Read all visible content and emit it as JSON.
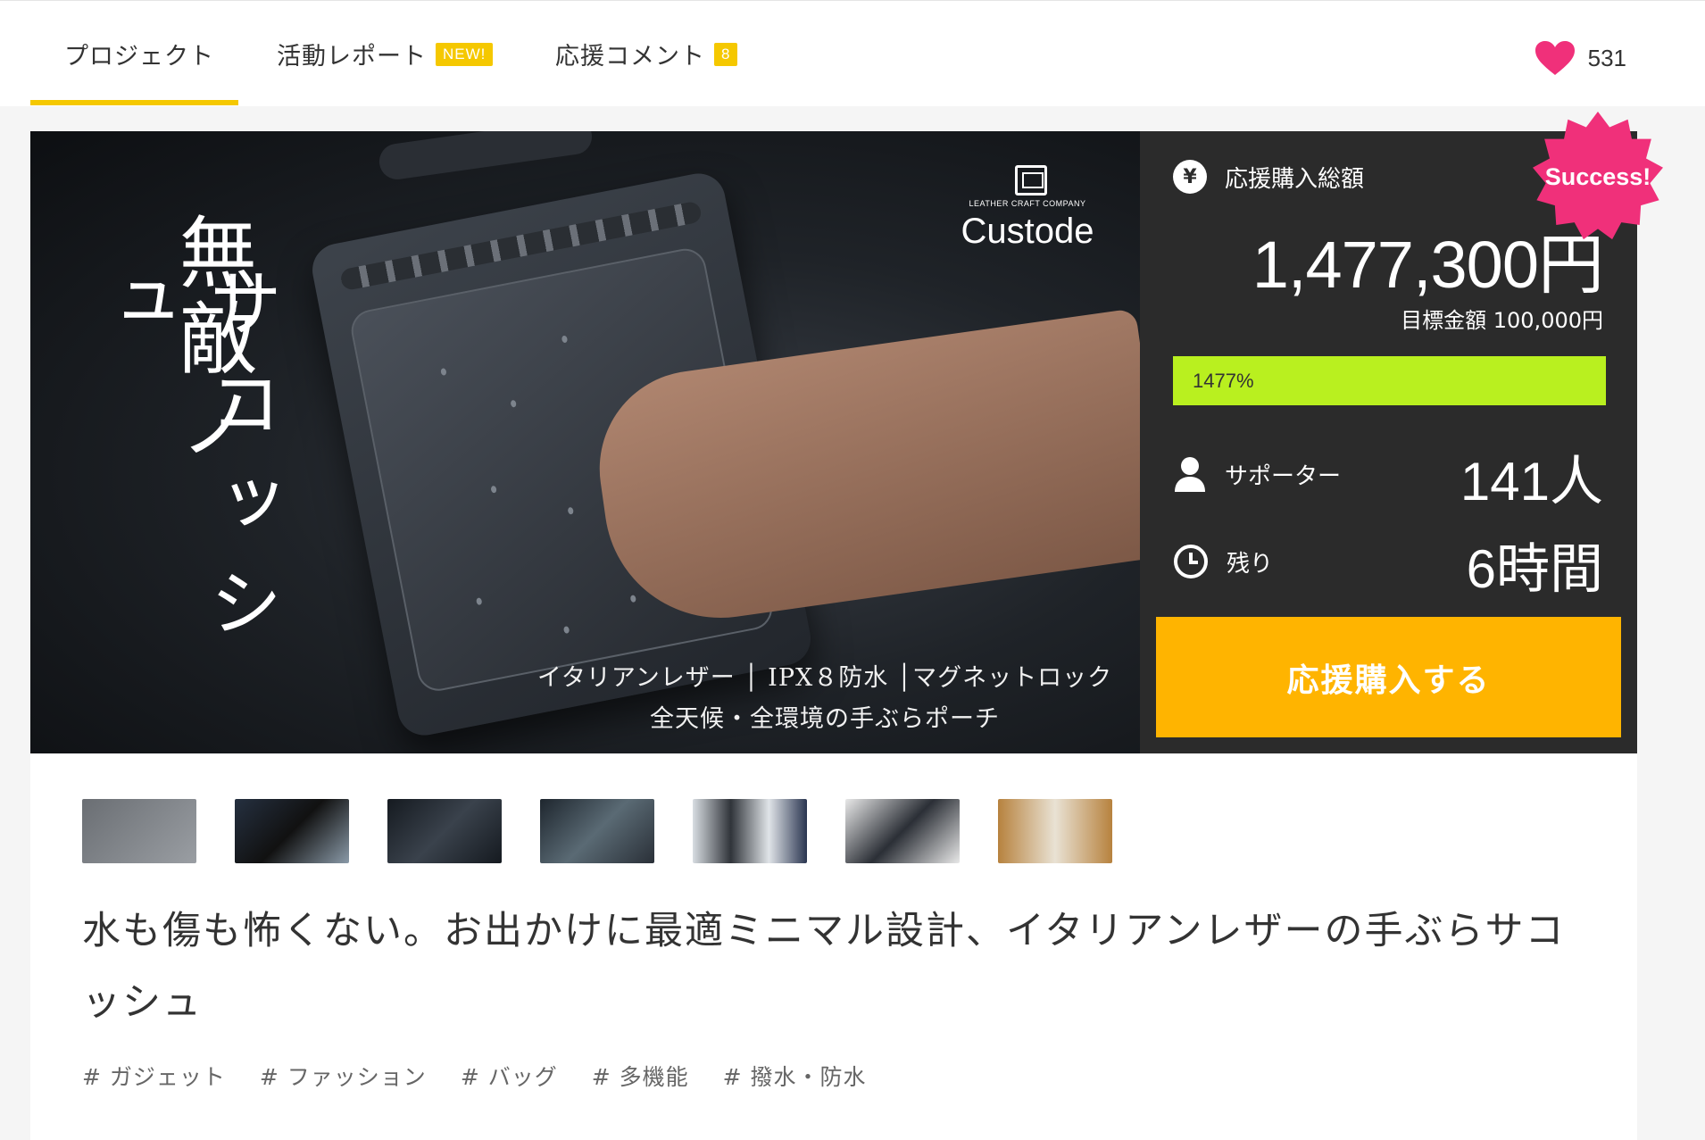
{
  "nav": {
    "tabs": [
      {
        "label": "プロジェクト",
        "badge": ""
      },
      {
        "label": "活動レポート",
        "badge": "NEW!"
      },
      {
        "label": "応援コメント",
        "badge": "8"
      }
    ],
    "active_tab": 0,
    "like_count": "531",
    "accent_color": "#f5c800",
    "heart_color": "#f0307a"
  },
  "hero": {
    "vertical_text_1": "無敵ノ",
    "vertical_text_2": "サコッシュ",
    "brand_small": "LEATHER CRAFT COMPANY",
    "brand_name": "Custode",
    "features_line1": "イタリアンレザー │ IPX８防水 │マグネットロック",
    "features_line2": "全天候・全環境の手ぶらポーチ"
  },
  "panel": {
    "total_label": "応援購入総額",
    "total_icon": "yen-icon",
    "amount": "1,477,300円",
    "goal": "目標金額 100,000円",
    "progress_text": "1477%",
    "progress_fraction": 1.0,
    "progress_color": "#b9f01f",
    "supporters_label": "サポーター",
    "supporters_value": "141人",
    "remaining_label": "残り",
    "remaining_value": "6時間",
    "cta_label": "応援購入する",
    "cta_color": "#ffb400",
    "success_label": "Success!"
  },
  "thumbnails": [
    {
      "alt": "thumbnail-1"
    },
    {
      "alt": "thumbnail-2"
    },
    {
      "alt": "thumbnail-3"
    },
    {
      "alt": "thumbnail-4"
    },
    {
      "alt": "thumbnail-5"
    },
    {
      "alt": "thumbnail-6"
    },
    {
      "alt": "thumbnail-7"
    }
  ],
  "title": "水も傷も怖くない。お出かけに最適ミニマル設計、イタリアンレザーの手ぶらサコッシュ",
  "tags": [
    "# ガジェット",
    "# ファッション",
    "# バッグ",
    "# 多機能",
    "# 撥水・防水"
  ]
}
